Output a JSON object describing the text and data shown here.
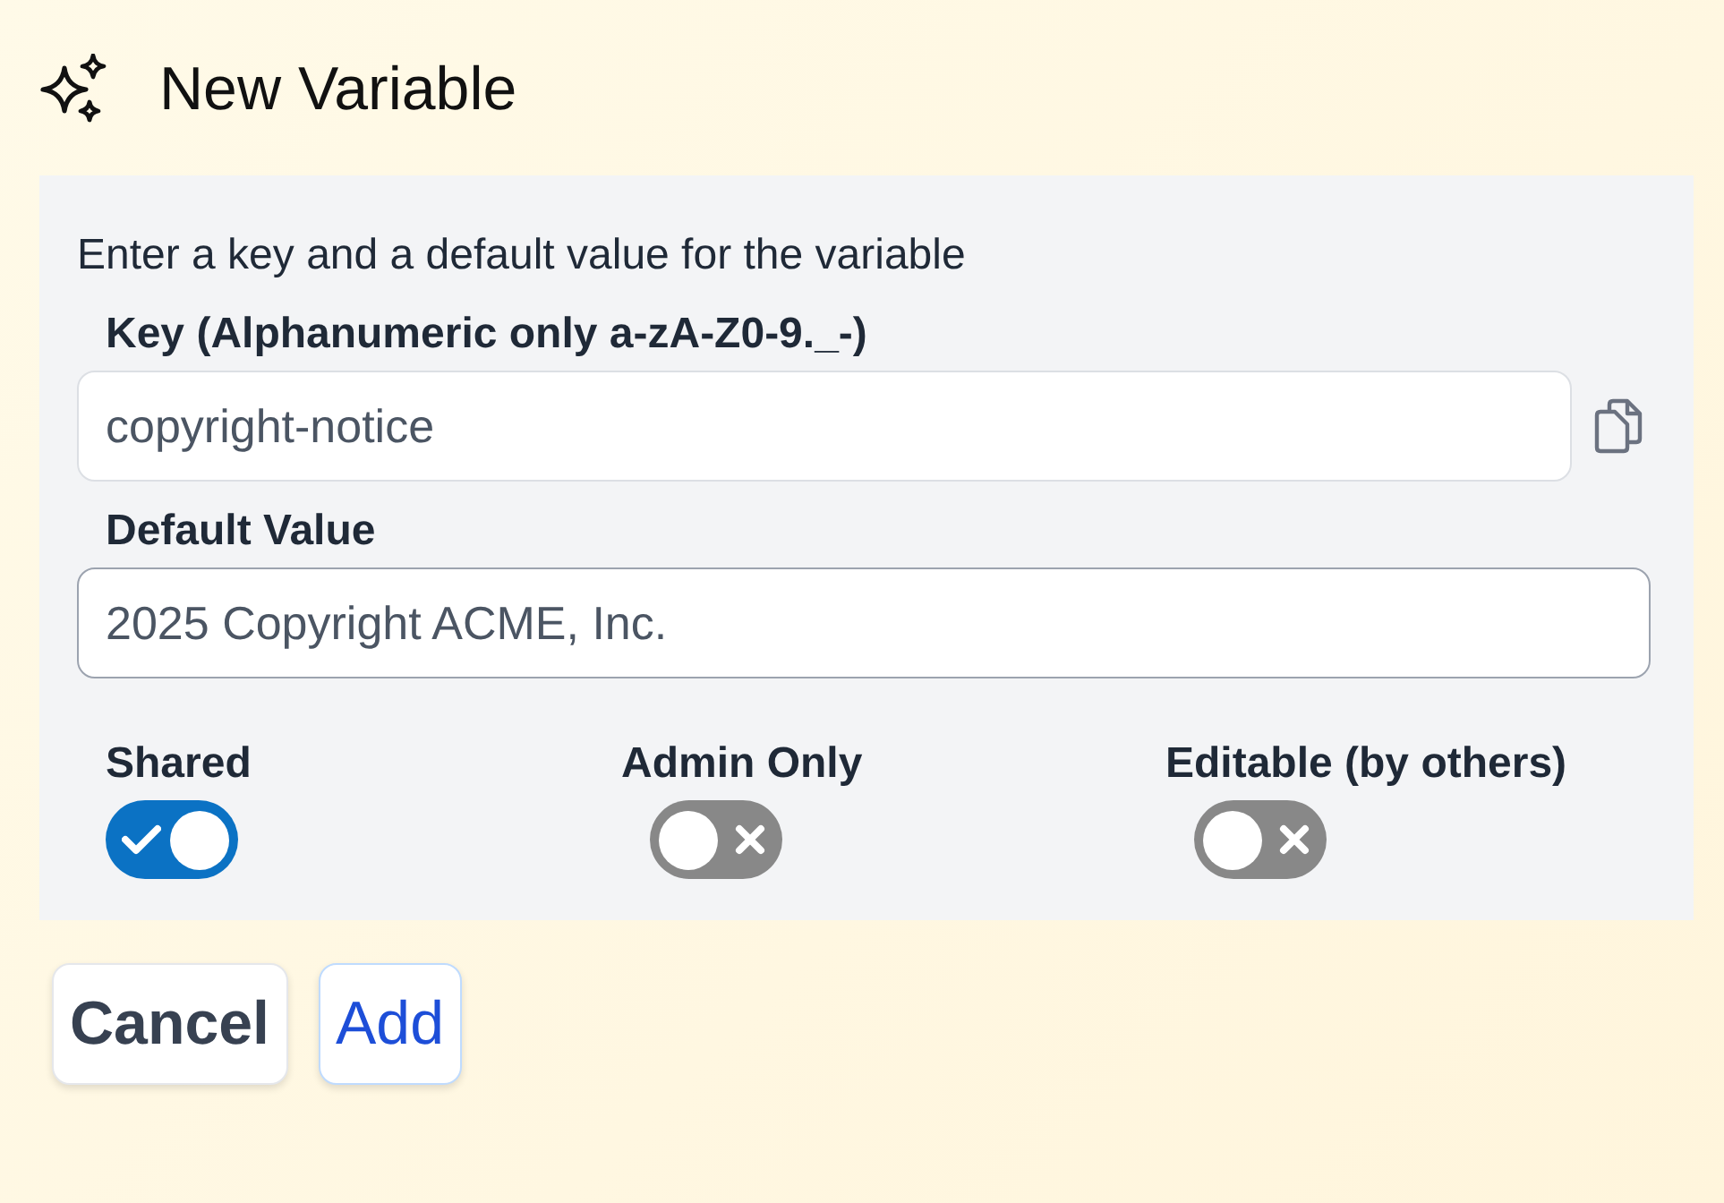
{
  "title": "New Variable",
  "description": "Enter a key and a default value for the variable",
  "fields": [
    {
      "kind": "copyable",
      "label": "Key (Alphanumeric only a-zA-Z0-9._-)",
      "value": "copyright-notice"
    },
    {
      "kind": "text",
      "label": "Default Value",
      "value": "2025 Copyright ACME, Inc."
    }
  ],
  "toggles": [
    {
      "label": "Shared",
      "on": true
    },
    {
      "label": "Admin Only",
      "on": false
    },
    {
      "label": "Editable (by others)",
      "on": false
    }
  ],
  "buttons": [
    {
      "label": "Cancel",
      "kind": "secondary"
    },
    {
      "label": "Add",
      "kind": "primary"
    }
  ]
}
